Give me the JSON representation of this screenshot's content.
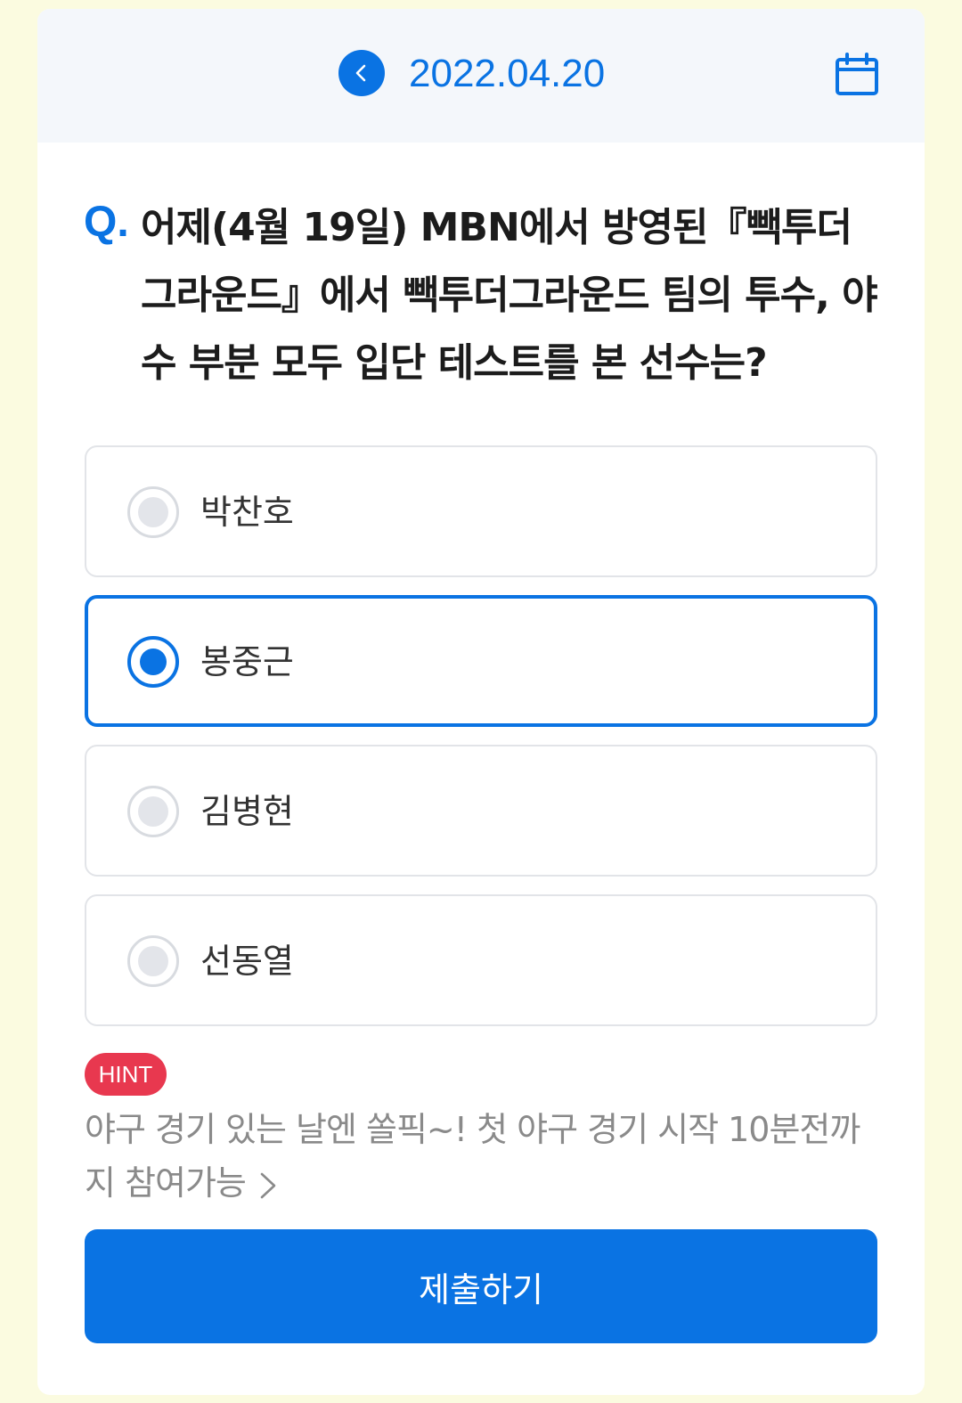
{
  "header": {
    "date": "2022.04.20",
    "back_icon": "chevron-left-icon",
    "calendar_icon": "calendar-icon"
  },
  "question": {
    "marker": "Q.",
    "text": "어제(4월 19일) MBN에서 방영된『빽투더 그라운드』에서 빽투더그라운드 팀의 투수, 야수 부분 모두 입단 테스트를 본 선수는?"
  },
  "options": [
    {
      "label": "박찬호",
      "selected": false
    },
    {
      "label": "봉중근",
      "selected": true
    },
    {
      "label": "김병현",
      "selected": false
    },
    {
      "label": "선동열",
      "selected": false
    }
  ],
  "hint": {
    "badge": "HINT",
    "text": "야구 경기 있는 날엔 쏠픽~! 첫 야구 경기 시작 10분전까지 참여가능"
  },
  "submit": {
    "label": "제출하기"
  },
  "colors": {
    "accent": "#0a73e3",
    "hint_badge": "#e8384f",
    "page_bg": "#fbfbe0",
    "header_bg": "#f4f7fb"
  }
}
